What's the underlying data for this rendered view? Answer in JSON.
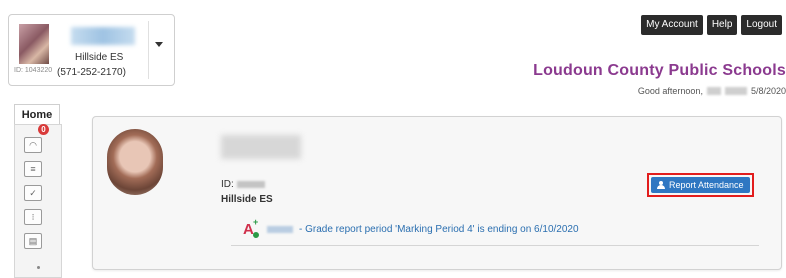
{
  "student_selector": {
    "id_label": "ID: 1043220",
    "school": "Hillside ES",
    "phone": "(571-252-2170)"
  },
  "top_nav": {
    "buttons": [
      "My Account",
      "Help",
      "Logout"
    ]
  },
  "header": {
    "district": "Loudoun County Public Schools",
    "greeting": "Good afternoon,",
    "date": "5/8/2020"
  },
  "sidebar": {
    "home_tab": "Home",
    "notification_count": "0",
    "icons": [
      "gauge-icon",
      "calendar-list-icon",
      "checklist-icon",
      "schedule-icon",
      "gradebook-icon"
    ]
  },
  "student_panel": {
    "id_label": "ID:",
    "school": "Hillside ES",
    "report_attendance_label": "Report Attendance",
    "grade_notice": "- Grade report period 'Marking Period 4' is ending on 6/10/2020"
  },
  "colors": {
    "district": "#8b3a8f",
    "report_button": "#2f77c2",
    "highlight_box": "#e21d1d",
    "top_buttons": "#2b2b2b",
    "link": "#2b6fb0"
  }
}
